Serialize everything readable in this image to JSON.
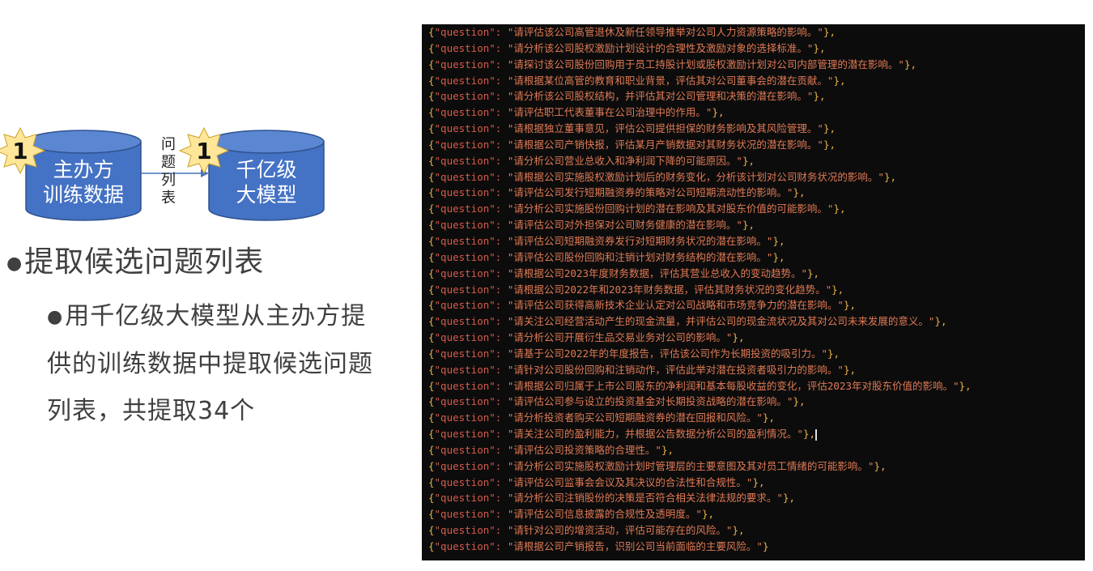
{
  "diagram": {
    "source_label": "主办方\n训练数据",
    "target_label": "千亿级\n大模型",
    "arrow_label": [
      "问",
      "题",
      "列",
      "表"
    ],
    "badge_number": "1",
    "colors": {
      "cylinder": "#4472c4",
      "badge": "#ffe699",
      "arrow": "#4472c4"
    }
  },
  "bullets": {
    "level1": "提取候选问题列表",
    "level2": "用千亿级大模型从主办方提供的训练数据中提取候选问题列表，共提取34个"
  },
  "code": {
    "key": "\"question\"",
    "lines": [
      "请评估该公司高管退休及新任领导推举对公司人力资源策略的影响。",
      "请分析该公司股权激励计划设计的合理性及激励对象的选择标准。",
      "请探讨该公司股份回购用于员工持股计划或股权激励计划对公司内部管理的潜在影响。",
      "请根据某位高管的教育和职业背景，评估其对公司董事会的潜在贡献。",
      "请分析该公司股权结构，并评估其对公司管理和决策的潜在影响。",
      "请评估职工代表董事在公司治理中的作用。",
      "请根据独立董事意见，评估公司提供担保的财务影响及其风险管理。",
      "请根据公司产销快报，评估某月产销数据对其财务状况的潜在影响。",
      "请分析公司营业总收入和净利润下降的可能原因。",
      "请根据公司实施股权激励计划后的财务变化，分析该计划对公司财务状况的影响。",
      "请评估公司发行短期融资券的策略对公司短期流动性的影响。",
      "请分析公司实施股份回购计划的潜在影响及其对股东价值的可能影响。",
      "请评估公司对外担保对公司财务健康的潜在影响。",
      "请评估公司短期融资券发行对短期财务状况的潜在影响。",
      "请评估公司股份回购和注销计划对财务结构的潜在影响。",
      "请根据公司2023年度财务数据，评估其营业总收入的变动趋势。",
      "请根据公司2022年和2023年财务数据，评估其财务状况的变化趋势。",
      "请评估公司获得高新技术企业认定对公司战略和市场竞争力的潜在影响。",
      "请关注公司经营活动产生的现金流量，并评估公司的现金流状况及其对公司未来发展的意义。",
      "请分析公司开展衍生品交易业务对公司的影响。",
      "请基于公司2022年的年度报告，评估该公司作为长期投资的吸引力。",
      "请针对公司股份回购和注销动作，评估此举对潜在投资者吸引力的影响。",
      "请根据公司归属于上市公司股东的净利润和基本每股收益的变化，评估2023年对股东价值的影响。",
      "请评估公司参与设立的投资基金对长期投资战略的潜在影响。",
      "请分析投资者购买公司短期融资券的潜在回报和风险。",
      "请关注公司的盈利能力，并根据公告数据分析公司的盈利情况。",
      "请评估公司投资策略的合理性。",
      "请分析公司实施股权激励计划时管理层的主要意图及其对员工情绪的可能影响。",
      "请评估公司监事会会议及其决议的合法性和合规性。",
      "请分析公司注销股份的决策是否符合相关法律法规的要求。",
      "请评估公司信息披露的合规性及透明度。",
      "请针对公司的增资活动，评估可能存在的风险。",
      "请根据公司产销报告，识别公司当前面临的主要风险。"
    ],
    "colors": {
      "background": "#0c0c0c",
      "brace": "#e8b04a",
      "key": "#d65c4a",
      "value": "#e07a55"
    }
  }
}
